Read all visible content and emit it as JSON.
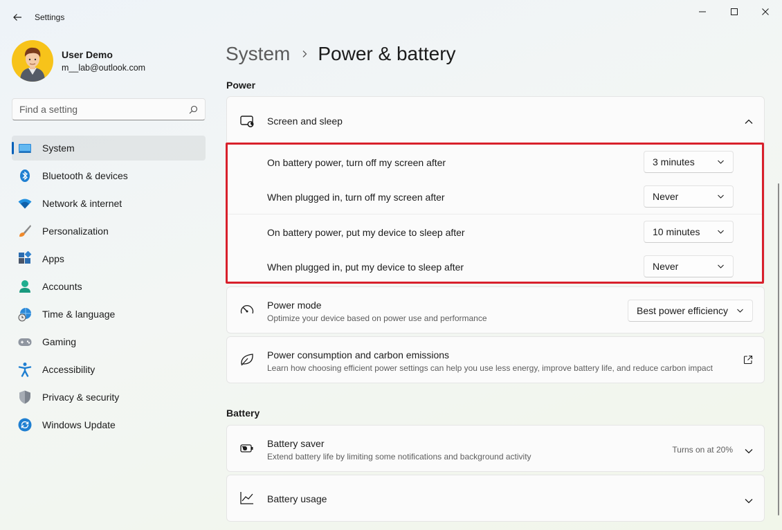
{
  "window": {
    "title": "Settings"
  },
  "profile": {
    "name": "User Demo",
    "email": "m__lab@outlook.com"
  },
  "search": {
    "placeholder": "Find a setting"
  },
  "nav": {
    "items": [
      {
        "label": "System",
        "icon": "system-icon",
        "active": true
      },
      {
        "label": "Bluetooth & devices",
        "icon": "bluetooth-icon"
      },
      {
        "label": "Network & internet",
        "icon": "wifi-icon"
      },
      {
        "label": "Personalization",
        "icon": "brush-icon"
      },
      {
        "label": "Apps",
        "icon": "apps-icon"
      },
      {
        "label": "Accounts",
        "icon": "person-icon"
      },
      {
        "label": "Time & language",
        "icon": "globe-clock-icon"
      },
      {
        "label": "Gaming",
        "icon": "gamepad-icon"
      },
      {
        "label": "Accessibility",
        "icon": "accessibility-icon"
      },
      {
        "label": "Privacy & security",
        "icon": "shield-icon"
      },
      {
        "label": "Windows Update",
        "icon": "update-icon"
      }
    ]
  },
  "breadcrumb": {
    "parent": "System",
    "current": "Power & battery"
  },
  "power": {
    "section_title": "Power",
    "screen_sleep": {
      "title": "Screen and sleep",
      "icon": "screen-sleep-icon",
      "rows": [
        {
          "label": "On battery power, turn off my screen after",
          "value": "3 minutes"
        },
        {
          "label": "When plugged in, turn off my screen after",
          "value": "Never"
        },
        {
          "label": "On battery power, put my device to sleep after",
          "value": "10 minutes"
        },
        {
          "label": "When plugged in, put my device to sleep after",
          "value": "Never"
        }
      ]
    },
    "power_mode": {
      "title": "Power mode",
      "desc": "Optimize your device based on power use and performance",
      "value": "Best power efficiency",
      "icon": "gauge-icon"
    },
    "consumption": {
      "title": "Power consumption and carbon emissions",
      "desc": "Learn how choosing efficient power settings can help you use less energy, improve battery life, and reduce carbon impact",
      "icon": "leaf-icon"
    }
  },
  "battery": {
    "section_title": "Battery",
    "saver": {
      "title": "Battery saver",
      "desc": "Extend battery life by limiting some notifications and background activity",
      "status": "Turns on at 20%",
      "icon": "battery-saver-icon"
    },
    "usage": {
      "title": "Battery usage",
      "icon": "chart-icon"
    }
  },
  "colors": {
    "accent": "#005fb8",
    "highlight": "#d8202b",
    "avatar_bg": "#f7c31a"
  }
}
